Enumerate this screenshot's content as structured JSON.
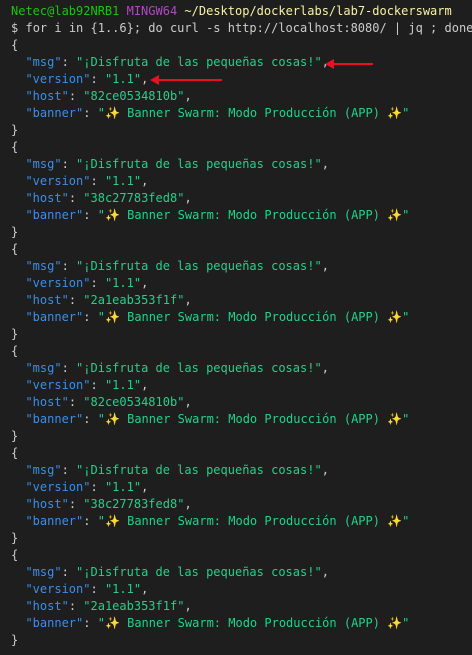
{
  "prompt": {
    "user_host": "Netec@lab92NRB1",
    "shell": "MINGW64",
    "path": "~/Desktop/dockerlabs/lab7-dockerswarm",
    "symbol": "$",
    "command": "for i in {1..6}; do curl -s http://localhost:8080/ | jq ; done"
  },
  "responses": [
    {
      "msg": "¡Disfruta de las pequeñas cosas!",
      "version": "1.1",
      "host": "82ce0534810b",
      "banner": "✨ Banner Swarm: Modo Producción (APP) ✨"
    },
    {
      "msg": "¡Disfruta de las pequeñas cosas!",
      "version": "1.1",
      "host": "38c27783fed8",
      "banner": "✨ Banner Swarm: Modo Producción (APP) ✨"
    },
    {
      "msg": "¡Disfruta de las pequeñas cosas!",
      "version": "1.1",
      "host": "2a1eab353f1f",
      "banner": "✨ Banner Swarm: Modo Producción (APP) ✨"
    },
    {
      "msg": "¡Disfruta de las pequeñas cosas!",
      "version": "1.1",
      "host": "82ce0534810b",
      "banner": "✨ Banner Swarm: Modo Producción (APP) ✨"
    },
    {
      "msg": "¡Disfruta de las pequeñas cosas!",
      "version": "1.1",
      "host": "38c27783fed8",
      "banner": "✨ Banner Swarm: Modo Producción (APP) ✨"
    },
    {
      "msg": "¡Disfruta de las pequeñas cosas!",
      "version": "1.1",
      "host": "2a1eab353f1f",
      "banner": "✨ Banner Swarm: Modo Producción (APP) ✨"
    }
  ],
  "colors": {
    "background": "#1e1e1e",
    "key": "#3b8eea",
    "string": "#23d18b",
    "annotation_arrow": "#e81123"
  }
}
